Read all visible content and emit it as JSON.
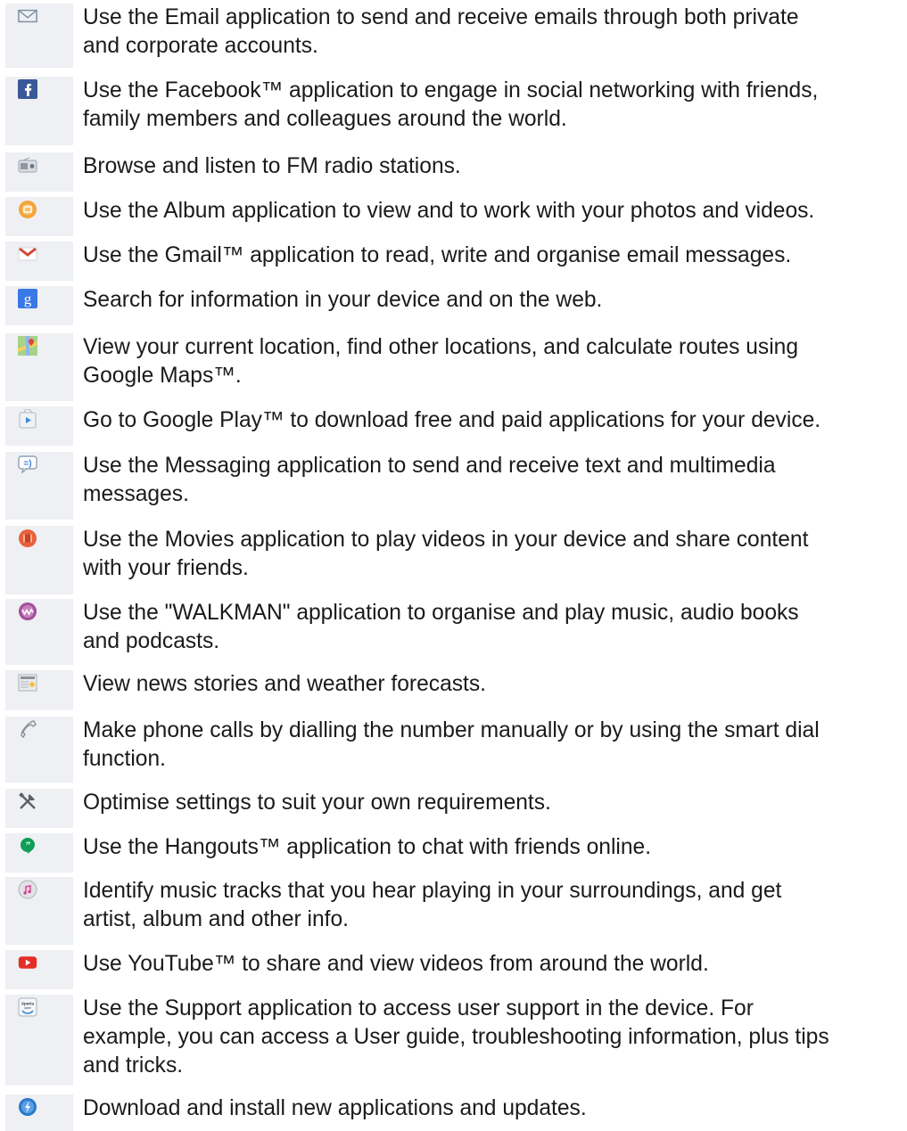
{
  "apps": [
    {
      "icon": "email-envelope-icon",
      "lines": [
        "Use the Email application to send and receive emails through both private",
        "and corporate accounts."
      ]
    },
    {
      "icon": "facebook-icon",
      "lines": [
        "Use the Facebook™ application to engage in social networking with friends,",
        "family members and colleagues around the world."
      ]
    },
    {
      "icon": "fm-radio-icon",
      "lines": [
        "Browse and listen to FM radio stations."
      ]
    },
    {
      "icon": "album-icon",
      "lines": [
        "Use the Album application to view and to work with your photos and videos."
      ]
    },
    {
      "icon": "gmail-icon",
      "lines": [
        "Use the Gmail™ application to read, write and organise email messages."
      ]
    },
    {
      "icon": "google-search-icon",
      "lines": [
        "Search for information in your device and on the web."
      ]
    },
    {
      "icon": "google-maps-icon",
      "lines": [
        "View your current location, find other locations, and calculate routes using",
        "Google Maps™."
      ]
    },
    {
      "icon": "google-play-icon",
      "lines": [
        "Go to Google Play™ to download free and paid applications for your device."
      ]
    },
    {
      "icon": "messaging-icon",
      "lines": [
        "Use the Messaging application to send and receive text and multimedia",
        "messages."
      ]
    },
    {
      "icon": "movies-icon",
      "lines": [
        "Use the Movies application to play videos in your device and share content",
        "with your friends."
      ]
    },
    {
      "icon": "walkman-icon",
      "lines": [
        "Use the \"WALKMAN\" application to organise and play music, audio books",
        "and podcasts."
      ]
    },
    {
      "icon": "news-weather-icon",
      "lines": [
        "View news stories and weather forecasts."
      ]
    },
    {
      "icon": "phone-icon",
      "lines": [
        "Make phone calls by dialling the number manually or by using the smart dial",
        "function."
      ]
    },
    {
      "icon": "settings-tools-icon",
      "lines": [
        "Optimise settings to suit your own requirements."
      ]
    },
    {
      "icon": "hangouts-icon",
      "lines": [
        "Use the Hangouts™ application to chat with friends online."
      ]
    },
    {
      "icon": "trackid-icon",
      "lines": [
        "Identify music tracks that you hear playing in your surroundings, and get",
        "artist, album and other info."
      ]
    },
    {
      "icon": "youtube-icon",
      "lines": [
        "Use YouTube™ to share and view videos from around the world."
      ]
    },
    {
      "icon": "support-icon",
      "icon_text": "Xperia care",
      "lines": [
        "Use the Support application to access user support in the device. For",
        "example, you can access a User guide, troubleshooting information, plus tips",
        "and tricks."
      ]
    },
    {
      "icon": "update-center-icon",
      "lines": [
        "Download and install new applications and updates."
      ]
    }
  ],
  "colors": {
    "icon_cell_bg": "#eef0f3",
    "text": "#1a1a1a",
    "facebook": "#3b5998",
    "gmail_red": "#d44638",
    "google_blue": "#3b78e7",
    "youtube_red": "#e52d27",
    "hangouts_green": "#0f9d58"
  }
}
